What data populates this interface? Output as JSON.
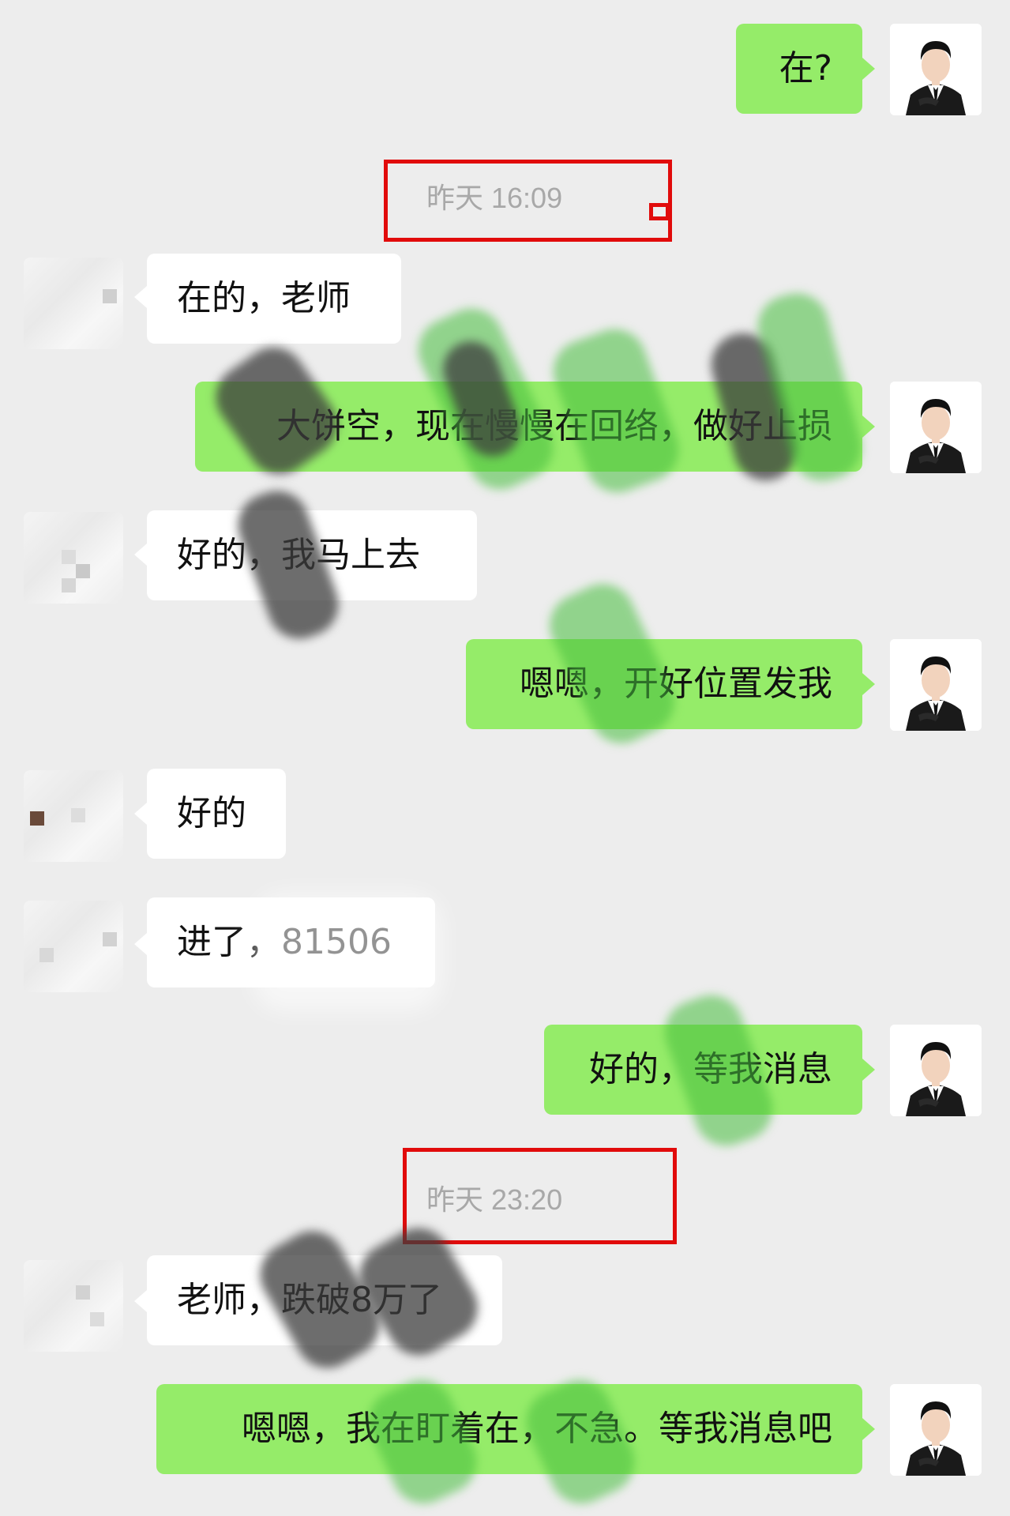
{
  "timestamps": [
    "昨天 16:09",
    "昨天 23:20"
  ],
  "messages": [
    {
      "from": "self",
      "text": "在?"
    },
    {
      "from": "other",
      "text": "在的，老师"
    },
    {
      "from": "self",
      "text": "大饼空，现在慢慢在回络，做好止损"
    },
    {
      "from": "other",
      "text": "好的，我马上去"
    },
    {
      "from": "self",
      "text": "嗯嗯，开好位置发我"
    },
    {
      "from": "other",
      "text": "好的"
    },
    {
      "from": "other",
      "text": "进了，81506"
    },
    {
      "from": "self",
      "text": "好的，等我消息"
    },
    {
      "from": "other",
      "text": "老师，跌破8万了"
    },
    {
      "from": "self",
      "text": "嗯嗯，我在盯着在，不急。等我消息吧"
    }
  ],
  "colors": {
    "background": "#ededed",
    "self_bubble": "#95ec69",
    "other_bubble": "#ffffff",
    "highlight_box": "#e10b0b",
    "timestamp_text": "#a8a8a8"
  },
  "icons": {
    "self_avatar": "businessman-avatar-icon",
    "other_avatar": "blurred-avatar-icon"
  }
}
